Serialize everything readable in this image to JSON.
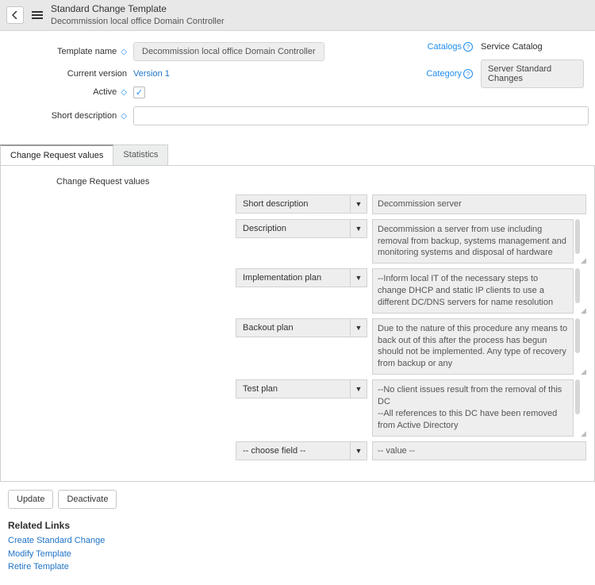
{
  "header": {
    "title": "Standard Change Template",
    "subtitle": "Decommission local office Domain Controller"
  },
  "form": {
    "labels": {
      "template_name": "Template name",
      "current_version": "Current version",
      "active": "Active",
      "short_description": "Short description",
      "catalogs": "Catalogs",
      "category": "Category"
    },
    "template_name_value": "Decommission local office Domain Controller",
    "current_version_value": "Version 1",
    "active_checked": "✓",
    "catalogs_value": "Service Catalog",
    "category_value": "Server Standard Changes"
  },
  "tabs": {
    "change_request_values": "Change Request values",
    "statistics": "Statistics"
  },
  "crv": {
    "section_label": "Change Request values",
    "rows": [
      {
        "field": "Short description",
        "value": "Decommission server",
        "multi": false,
        "scroll": false
      },
      {
        "field": "Description",
        "value": "Decommission a server from use including removal from backup, systems management and monitoring systems and disposal of hardware",
        "multi": true,
        "scroll": true
      },
      {
        "field": "Implementation plan",
        "value": "--Inform local IT of the necessary steps to change DHCP and static IP clients to use a different DC/DNS servers for name resolution",
        "multi": true,
        "scroll": true
      },
      {
        "field": "Backout plan",
        "value": "Due to the nature of this procedure any means to back out of this after the process has begun should not be implemented. Any type of recovery from backup or any",
        "multi": true,
        "scroll": true
      },
      {
        "field": "Test plan",
        "value": "--No client issues result from the removal of this DC\n--All references to this DC have been removed from Active Directory",
        "multi": true,
        "scroll": true
      },
      {
        "field": "-- choose field --",
        "value": "-- value --",
        "multi": false,
        "scroll": false
      }
    ]
  },
  "buttons": {
    "update": "Update",
    "deactivate": "Deactivate"
  },
  "related": {
    "heading": "Related Links",
    "links": {
      "create": "Create Standard Change",
      "modify": "Modify Template",
      "retire": "Retire Template"
    }
  }
}
